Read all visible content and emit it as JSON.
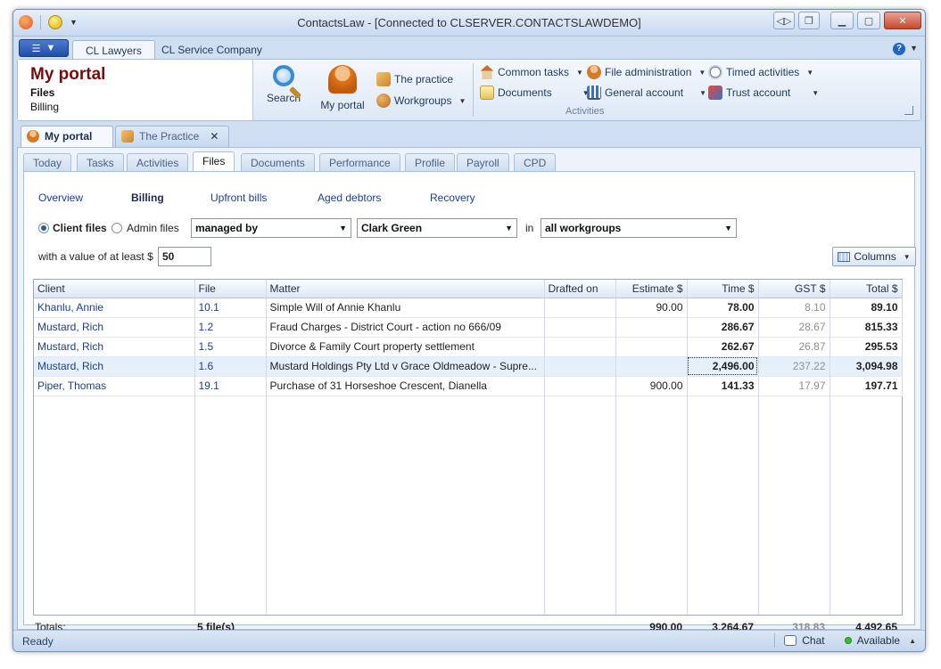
{
  "window": {
    "title": "ContactsLaw - [Connected to CLSERVER.CONTACTSLAWDEMO]"
  },
  "ribbon_tabs": [
    "CL Lawyers",
    "CL Service Company"
  ],
  "portal": {
    "title": "My portal",
    "subtitle1": "Files",
    "subtitle2": "Billing"
  },
  "ribbon": {
    "search": "Search",
    "my_portal": "My portal",
    "the_practice": "The practice",
    "workgroups": "Workgroups",
    "common_tasks": "Common tasks",
    "documents": "Documents",
    "file_administration": "File administration",
    "general_account": "General account",
    "timed_activities": "Timed activities",
    "trust_account": "Trust account",
    "group_label": "Activities"
  },
  "doc_tabs": [
    {
      "label": "My portal"
    },
    {
      "label": "The Practice",
      "close": "✕"
    }
  ],
  "sub_tabs": [
    "Today",
    "Tasks",
    "Activities",
    "Files",
    "Documents",
    "Performance",
    "Profile",
    "Payroll",
    "CPD"
  ],
  "active_sub_tab": "Files",
  "links": [
    "Overview",
    "Billing",
    "Upfront bills",
    "Aged debtors",
    "Recovery"
  ],
  "filters": {
    "client_files": "Client files",
    "admin_files": "Admin files",
    "managed_by": "managed by",
    "person": "Clark Green",
    "in_label": "in",
    "workgroups": "all workgroups",
    "value_label": "with a value of at least $",
    "value": "50",
    "columns_button": "Columns"
  },
  "table": {
    "headers": [
      "Client",
      "File",
      "Matter",
      "Drafted on",
      "Estimate $",
      "Time $",
      "GST $",
      "Total $"
    ],
    "rows": [
      {
        "client": "Khanlu, Annie",
        "file": "10.1",
        "matter": "Simple Will of Annie Khanlu",
        "drafted": "",
        "estimate": "90.00",
        "time": "78.00",
        "gst": "8.10",
        "total": "89.10"
      },
      {
        "client": "Mustard, Rich",
        "file": "1.2",
        "matter": "Fraud Charges - District Court - action no 666/09",
        "drafted": "",
        "estimate": "",
        "time": "286.67",
        "gst": "28.67",
        "total": "815.33"
      },
      {
        "client": "Mustard, Rich",
        "file": "1.5",
        "matter": "Divorce & Family Court property settlement",
        "drafted": "",
        "estimate": "",
        "time": "262.67",
        "gst": "26.87",
        "total": "295.53"
      },
      {
        "client": "Mustard, Rich",
        "file": "1.6",
        "matter": "Mustard Holdings Pty Ltd v Grace Oldmeadow - Supre...",
        "drafted": "",
        "estimate": "",
        "time": "2,496.00",
        "gst": "237.22",
        "total": "3,094.98"
      },
      {
        "client": "Piper, Thomas",
        "file": "19.1",
        "matter": "Purchase of 31 Horseshoe Crescent, Dianella",
        "drafted": "",
        "estimate": "900.00",
        "time": "141.33",
        "gst": "17.97",
        "total": "197.71"
      }
    ],
    "totals": {
      "label": "Totals:",
      "files": "5 file(s)",
      "estimate": "990.00",
      "time": "3,264.67",
      "gst": "318.83",
      "total": "4,492.65"
    }
  },
  "statusbar": {
    "status": "Ready",
    "chat": "Chat",
    "availability": "Available"
  }
}
